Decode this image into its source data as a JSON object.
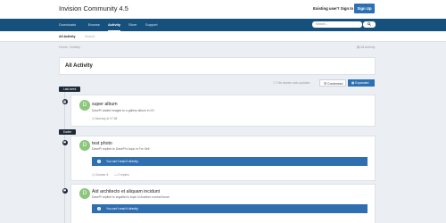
{
  "header": {
    "site_title": "Invision Community 4.5",
    "login_link": "Existing user? Sign In",
    "signup_label": "Sign Up"
  },
  "nav": {
    "items": [
      {
        "label": "Downloads"
      },
      {
        "label": "Browse"
      },
      {
        "label": "Activity"
      },
      {
        "label": "Store"
      },
      {
        "label": "Support"
      }
    ],
    "search_placeholder": "Search..."
  },
  "subnav": {
    "items": [
      {
        "label": "All Activity"
      },
      {
        "label": "Search"
      }
    ]
  },
  "breadcrumb": {
    "home": "Home",
    "sep": "›",
    "current": "Activity",
    "right": "All Activity"
  },
  "page": {
    "title": "All Activity",
    "updated_note": "This stream auto-updates",
    "condensed_label": "Condensed",
    "expanded_label": "Expanded"
  },
  "timeline": {
    "labels": [
      "Last week",
      "Earlier"
    ]
  },
  "activities": [
    {
      "avatar_letter": "D",
      "title": "super album",
      "subtitle": "DavePi added images to a gallery album in X3",
      "meta": "Monday at 07:58"
    },
    {
      "avatar_letter": "D",
      "title": "test photo",
      "subtitle": "DavePi replied to DavePi's topic in For Sell",
      "notice": "You can't read it directly.",
      "meta_date": "October 8",
      "meta_replies": "2 replies"
    },
    {
      "avatar_letter": "D",
      "title": "Aid architecto et aliquam incidunt",
      "subtitle": "DavePi replied to arguillen's topic in Another normal forum",
      "notice": "You can't read it directly."
    }
  ],
  "colors": {
    "nav_bg": "#16507c",
    "accent": "#2c6fb2",
    "avatar_bg": "#8cc67c",
    "timeline_dark": "#1e2a36",
    "notice_bg": "#2f6fb0"
  }
}
